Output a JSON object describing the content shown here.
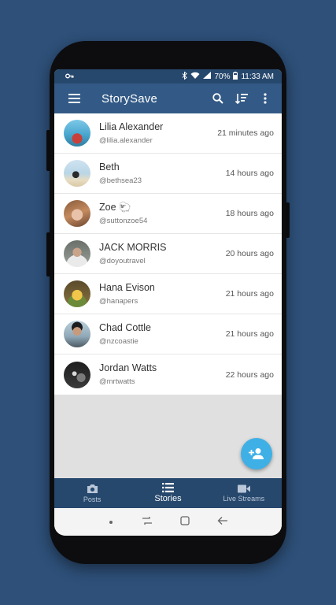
{
  "status": {
    "battery": "70%",
    "time": "11:33 AM"
  },
  "app": {
    "title": "StorySave"
  },
  "users": [
    {
      "name": "Lilia Alexander",
      "handle": "@lilia.alexander",
      "time": "21 minutes ago"
    },
    {
      "name": "Beth",
      "handle": "@bethsea23",
      "time": "14 hours ago"
    },
    {
      "name": "Zoe 🐑",
      "handle": "@suttonzoe54",
      "time": "18 hours ago"
    },
    {
      "name": "JACK MORRIS",
      "handle": "@doyoutravel",
      "time": "20 hours ago"
    },
    {
      "name": "Hana Evison",
      "handle": "@hanapers",
      "time": "21 hours ago"
    },
    {
      "name": "Chad Cottle",
      "handle": "@nzcoastie",
      "time": "21 hours ago"
    },
    {
      "name": "Jordan Watts",
      "handle": "@mrtwatts",
      "time": "22 hours ago"
    }
  ],
  "nav": {
    "posts": "Posts",
    "stories": "Stories",
    "live": "Live Streams"
  },
  "colors": {
    "background": "#2e5079",
    "appbar": "#335a86",
    "statusbar": "#27486d",
    "fab": "#3fb0e6"
  }
}
